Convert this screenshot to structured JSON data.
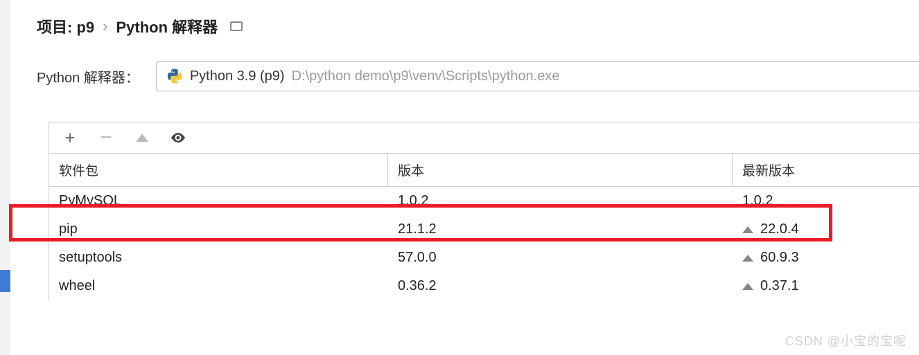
{
  "breadcrumb": {
    "project_label": "项目: p9",
    "separator": "›",
    "page_label": "Python 解释器"
  },
  "interpreter": {
    "label": "Python 解释器：",
    "name": "Python 3.9 (p9)",
    "path": "D:\\python demo\\p9\\venv\\Scripts\\python.exe"
  },
  "toolbar": {
    "add": "+",
    "remove": "−"
  },
  "columns": {
    "name": "软件包",
    "version": "版本",
    "latest": "最新版本"
  },
  "packages": [
    {
      "name": "PyMySQL",
      "version": "1.0.2",
      "latest": "1.0.2",
      "upgrade": false
    },
    {
      "name": "pip",
      "version": "21.1.2",
      "latest": "22.0.4",
      "upgrade": true
    },
    {
      "name": "setuptools",
      "version": "57.0.0",
      "latest": "60.9.3",
      "upgrade": true
    },
    {
      "name": "wheel",
      "version": "0.36.2",
      "latest": "0.37.1",
      "upgrade": true
    }
  ],
  "watermark": "CSDN @小宝的宝呢"
}
